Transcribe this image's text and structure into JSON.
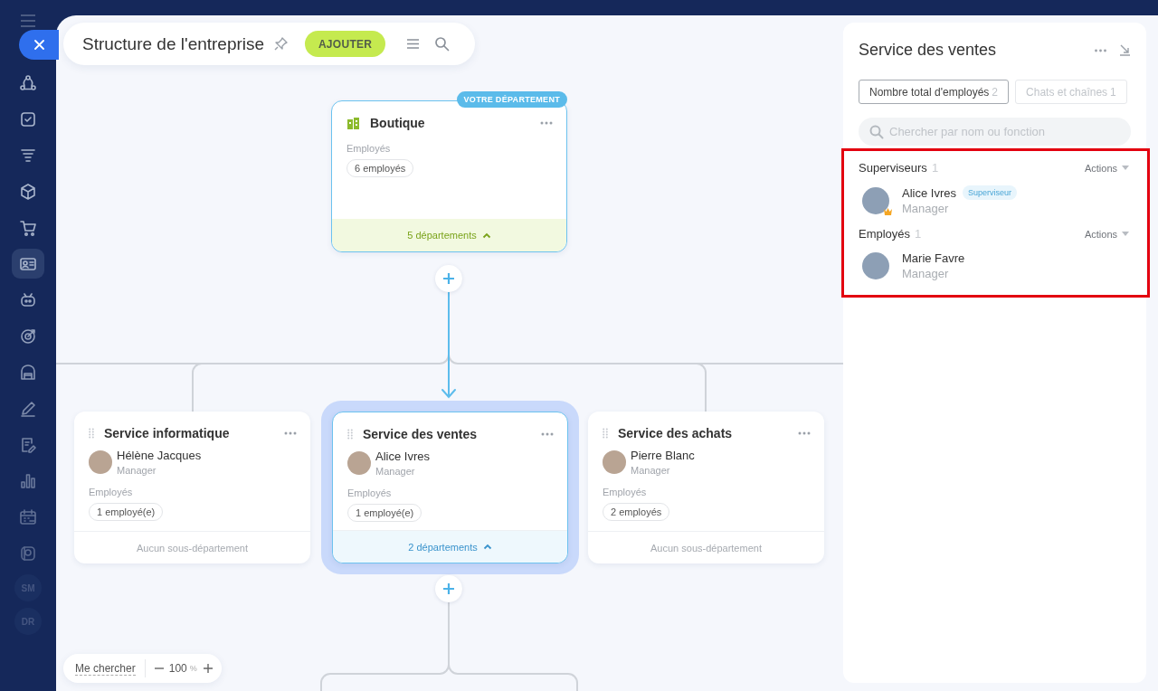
{
  "sidebar": {
    "items": [
      {
        "kind": "icon",
        "selected": false
      },
      {
        "kind": "icon",
        "selected": false
      },
      {
        "kind": "icon",
        "selected": false
      },
      {
        "kind": "icon",
        "selected": false
      },
      {
        "kind": "icon",
        "selected": false
      },
      {
        "kind": "icon",
        "selected": true
      },
      {
        "kind": "icon",
        "selected": false
      },
      {
        "kind": "icon",
        "selected": false
      },
      {
        "kind": "icon",
        "selected": false
      },
      {
        "kind": "icon",
        "selected": false
      },
      {
        "kind": "icon",
        "selected": false
      },
      {
        "kind": "icon",
        "selected": false
      },
      {
        "kind": "icon",
        "selected": false
      },
      {
        "kind": "icon",
        "selected": false
      },
      {
        "kind": "initials",
        "label": "SM",
        "selected": false
      },
      {
        "kind": "initials",
        "label": "DR",
        "selected": false
      }
    ]
  },
  "header": {
    "title": "Structure de l'entreprise",
    "add_button": "AJOUTER"
  },
  "org_chart": {
    "root": {
      "name": "Boutique",
      "badge": "VOTRE DÉPARTEMENT",
      "selected": false,
      "employees_label": "Employés",
      "employees_count": "6 employés",
      "footer": {
        "kind": "subdepartments",
        "text": "5 départements",
        "expanded": true
      }
    },
    "children": [
      {
        "name": "Service informatique",
        "selected": false,
        "head": {
          "name": "Hélène Jacques",
          "role": "Manager"
        },
        "employees_label": "Employés",
        "employees_count": "1 employé(e)",
        "footer": {
          "kind": "empty",
          "text": "Aucun sous-département"
        }
      },
      {
        "name": "Service des ventes",
        "selected": true,
        "head": {
          "name": "Alice Ivres",
          "role": "Manager"
        },
        "employees_label": "Employés",
        "employees_count": "1 employé(e)",
        "footer": {
          "kind": "subdepartments",
          "text": "2 départements",
          "expanded": true
        }
      },
      {
        "name": "Service des achats",
        "selected": false,
        "head": {
          "name": "Pierre Blanc",
          "role": "Manager"
        },
        "employees_label": "Employés",
        "employees_count": "2 employés",
        "footer": {
          "kind": "empty",
          "text": "Aucun sous-département"
        }
      }
    ]
  },
  "zoom_control": {
    "find_me": "Me chercher",
    "zoom": "100",
    "unit": "%"
  },
  "panel": {
    "title": "Service des ventes",
    "tabs": [
      {
        "label": "Nombre total d'employés",
        "count": "2",
        "selected": true
      },
      {
        "label": "Chats et chaînes",
        "count": "1",
        "selected": false
      }
    ],
    "search": {
      "placeholder": "Chercher par nom ou fonction"
    },
    "sections": [
      {
        "title": "Superviseurs",
        "count": "1",
        "actions": "Actions",
        "members": [
          {
            "name": "Alice Ivres",
            "tag": "Superviseur",
            "role": "Manager",
            "crowned": true
          }
        ]
      },
      {
        "title": "Employés",
        "count": "1",
        "actions": "Actions",
        "members": [
          {
            "name": "Marie Favre",
            "role": "Manager",
            "crowned": false
          }
        ]
      }
    ]
  }
}
